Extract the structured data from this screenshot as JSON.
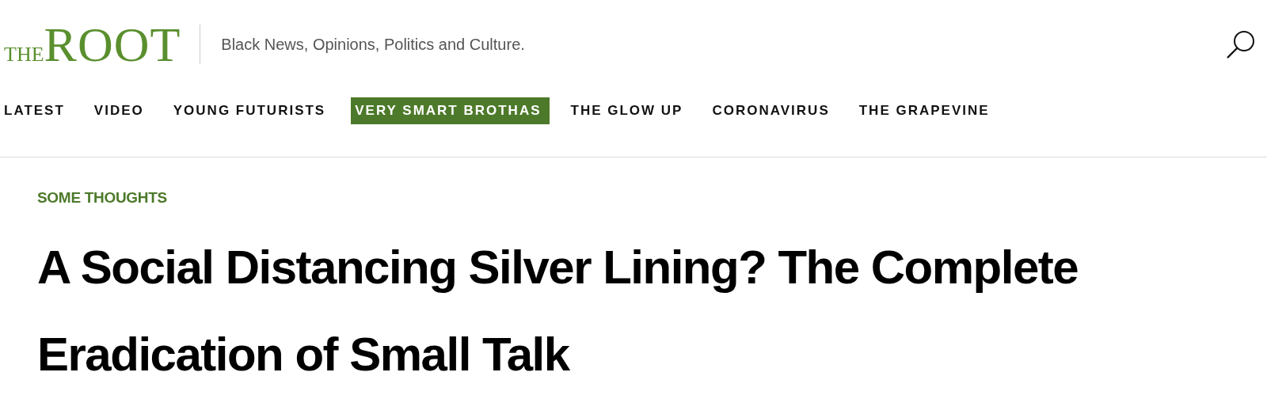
{
  "header": {
    "logo": {
      "small": "THE",
      "large": "ROOT"
    },
    "tagline": "Black News, Opinions, Politics and Culture."
  },
  "nav": [
    {
      "label": "LATEST",
      "selected": false
    },
    {
      "label": "VIDEO",
      "selected": false
    },
    {
      "label": "YOUNG FUTURISTS",
      "selected": false
    },
    {
      "label": "VERY SMART BROTHAS",
      "selected": true
    },
    {
      "label": "THE GLOW UP",
      "selected": false
    },
    {
      "label": "CORONAVIRUS",
      "selected": false
    },
    {
      "label": "THE GRAPEVINE",
      "selected": false
    }
  ],
  "article": {
    "kicker": "SOME THOUGHTS",
    "headline": "A Social Distancing Silver Lining? The Complete Eradication of Small Talk"
  }
}
